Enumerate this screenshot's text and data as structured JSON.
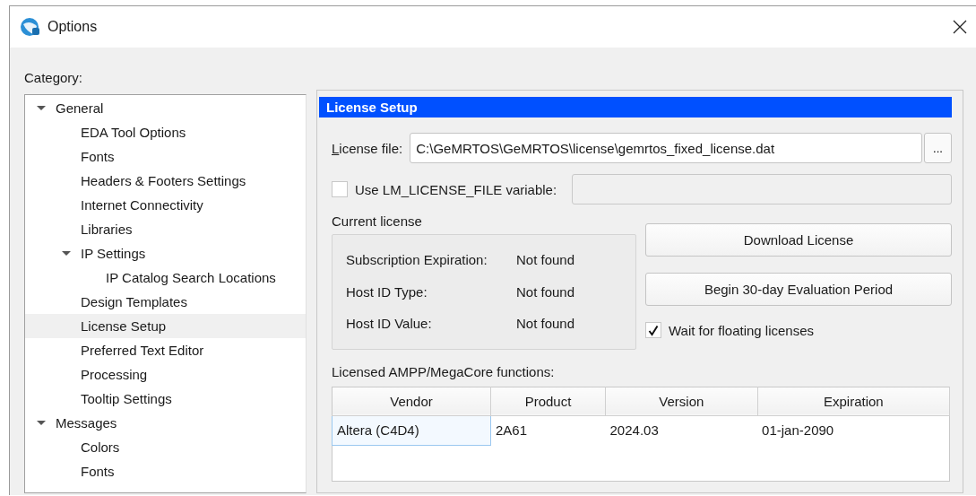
{
  "window": {
    "title": "Options"
  },
  "category_label": "Category:",
  "tree": [
    {
      "label": "General",
      "expanded": true,
      "selected": false,
      "children": [
        {
          "label": "EDA Tool Options",
          "selected": false
        },
        {
          "label": "Fonts",
          "selected": false
        },
        {
          "label": "Headers & Footers Settings",
          "selected": false
        },
        {
          "label": "Internet Connectivity",
          "selected": false
        },
        {
          "label": "Libraries",
          "selected": false
        },
        {
          "label": "IP Settings",
          "expanded": true,
          "selected": false,
          "children": [
            {
              "label": "IP Catalog Search Locations",
              "selected": false
            }
          ]
        },
        {
          "label": "Design Templates",
          "selected": false
        },
        {
          "label": "License Setup",
          "selected": true
        },
        {
          "label": "Preferred Text Editor",
          "selected": false
        },
        {
          "label": "Processing",
          "selected": false
        },
        {
          "label": "Tooltip Settings",
          "selected": false
        }
      ]
    },
    {
      "label": "Messages",
      "expanded": true,
      "selected": false,
      "children": [
        {
          "label": "Colors",
          "selected": false
        },
        {
          "label": "Fonts",
          "selected": false
        }
      ]
    }
  ],
  "panel": {
    "title": "License Setup",
    "license_file": {
      "label": "License file:",
      "value": "C:\\GeMRTOS\\GeMRTOS\\license\\gemrtos_fixed_license.dat"
    },
    "browse_button": "...",
    "lm_license": {
      "label": "Use LM_LICENSE_FILE variable:",
      "checked": false
    },
    "current_license": {
      "title": "Current license",
      "rows": [
        {
          "label": "Subscription Expiration:",
          "value": "Not found"
        },
        {
          "label": "Host ID Type:",
          "value": "Not found"
        },
        {
          "label": "Host ID Value:",
          "value": "Not found"
        }
      ]
    },
    "buttons": [
      "Download License",
      "Begin 30-day Evaluation Period"
    ],
    "wait_floating": {
      "label": "Wait for floating licenses",
      "checked": true
    },
    "functions": {
      "label": "Licensed AMPP/MegaCore functions:",
      "columns": [
        "Vendor",
        "Product",
        "Version",
        "Expiration"
      ],
      "rows": [
        {
          "cells": [
            "Altera (C4D4)",
            "2A61",
            "2024.03",
            "01-jan-2090"
          ],
          "selected": true
        }
      ]
    }
  }
}
